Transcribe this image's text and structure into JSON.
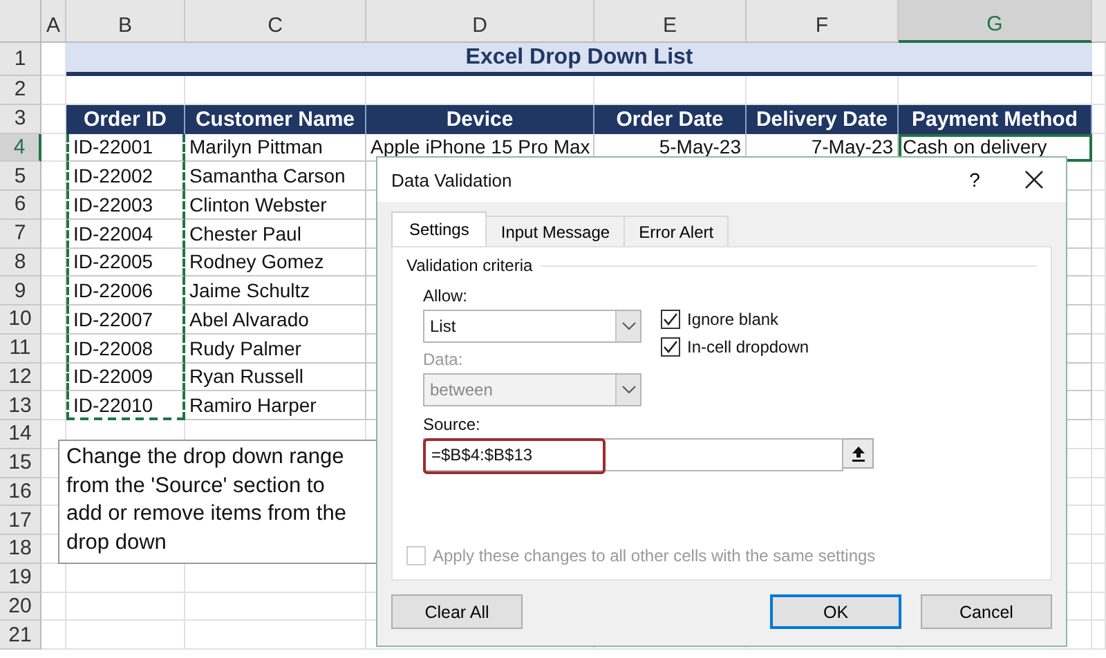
{
  "sheet": {
    "column_headers": [
      {
        "label": "A",
        "selected": false
      },
      {
        "label": "B",
        "selected": false
      },
      {
        "label": "C",
        "selected": false
      },
      {
        "label": "D",
        "selected": false
      },
      {
        "label": "E",
        "selected": false
      },
      {
        "label": "F",
        "selected": false
      },
      {
        "label": "G",
        "selected": true
      }
    ],
    "row_headers": [
      {
        "label": "1",
        "selected": false
      },
      {
        "label": "2",
        "selected": false
      },
      {
        "label": "3",
        "selected": false
      },
      {
        "label": "4",
        "selected": true
      },
      {
        "label": "5",
        "selected": false
      },
      {
        "label": "6",
        "selected": false
      },
      {
        "label": "7",
        "selected": false
      },
      {
        "label": "8",
        "selected": false
      },
      {
        "label": "9",
        "selected": false
      },
      {
        "label": "10",
        "selected": false
      },
      {
        "label": "11",
        "selected": false
      },
      {
        "label": "12",
        "selected": false
      },
      {
        "label": "13",
        "selected": false
      },
      {
        "label": "14",
        "selected": false
      },
      {
        "label": "15",
        "selected": false
      },
      {
        "label": "16",
        "selected": false
      },
      {
        "label": "17",
        "selected": false
      },
      {
        "label": "18",
        "selected": false
      },
      {
        "label": "19",
        "selected": false
      },
      {
        "label": "20",
        "selected": false
      },
      {
        "label": "21",
        "selected": false
      }
    ],
    "title": "Excel Drop Down List",
    "columns": [
      {
        "label": "Order ID",
        "copied": true
      },
      {
        "label": "Customer Name",
        "copied": false
      },
      {
        "label": "Device",
        "copied": false
      },
      {
        "label": "Order Date",
        "copied": false
      },
      {
        "label": "Delivery Date",
        "copied": false
      },
      {
        "label": "Payment Method",
        "copied": false
      }
    ],
    "rows": [
      {
        "cells": [
          {
            "text": "ID-22001",
            "selected": false
          },
          {
            "text": "Marilyn Pittman",
            "selected": false
          },
          {
            "text": "Apple iPhone 15 Pro Max",
            "selected": false
          },
          {
            "text": "5-May-23",
            "selected": false
          },
          {
            "text": "7-May-23",
            "selected": false
          },
          {
            "text": "Cash on delivery",
            "selected": true
          }
        ]
      },
      {
        "cells": [
          {
            "text": "ID-22002",
            "selected": false
          },
          {
            "text": "Samantha Carson",
            "selected": false
          }
        ]
      },
      {
        "cells": [
          {
            "text": "ID-22003",
            "selected": false
          },
          {
            "text": "Clinton Webster",
            "selected": false
          }
        ]
      },
      {
        "cells": [
          {
            "text": "ID-22004",
            "selected": false
          },
          {
            "text": "Chester Paul",
            "selected": false
          }
        ]
      },
      {
        "cells": [
          {
            "text": "ID-22005",
            "selected": false
          },
          {
            "text": "Rodney Gomez",
            "selected": false
          }
        ]
      },
      {
        "cells": [
          {
            "text": "ID-22006",
            "selected": false
          },
          {
            "text": "Jaime Schultz",
            "selected": false
          }
        ]
      },
      {
        "cells": [
          {
            "text": "ID-22007",
            "selected": false
          },
          {
            "text": "Abel Alvarado",
            "selected": false
          }
        ]
      },
      {
        "cells": [
          {
            "text": "ID-22008",
            "selected": false
          },
          {
            "text": "Rudy Palmer",
            "selected": false
          }
        ]
      },
      {
        "cells": [
          {
            "text": "ID-22009",
            "selected": false
          },
          {
            "text": "Ryan Russell",
            "selected": false
          }
        ]
      },
      {
        "cells": [
          {
            "text": "ID-22010",
            "selected": false
          },
          {
            "text": "Ramiro Harper",
            "selected": false
          }
        ]
      }
    ]
  },
  "callout": {
    "text": "Change the drop down range from the 'Source' section to add or remove items from the drop down"
  },
  "dialog": {
    "title": "Data Validation",
    "help": "?",
    "tabs": [
      {
        "label": "Settings",
        "selected": true
      },
      {
        "label": "Input Message",
        "selected": false
      },
      {
        "label": "Error Alert",
        "selected": false
      }
    ],
    "group_label": "Validation criteria",
    "allow": {
      "label": "Allow:",
      "value": "List",
      "disabled": false
    },
    "data": {
      "label": "Data:",
      "value": "between",
      "disabled": true
    },
    "checkboxes": [
      {
        "label": "Ignore blank",
        "checked": true,
        "disabled": false
      },
      {
        "label": "In-cell dropdown",
        "checked": true,
        "disabled": false
      }
    ],
    "source": {
      "label": "Source:",
      "value": "=$B$4:$B$13",
      "highlighted": true
    },
    "apply": {
      "label": "Apply these changes to all other cells with the same settings",
      "checked": false,
      "disabled": true
    },
    "buttons": [
      {
        "label": "Clear All",
        "default": false
      },
      {
        "label": "OK",
        "default": true
      },
      {
        "label": "Cancel",
        "default": false
      }
    ]
  }
}
